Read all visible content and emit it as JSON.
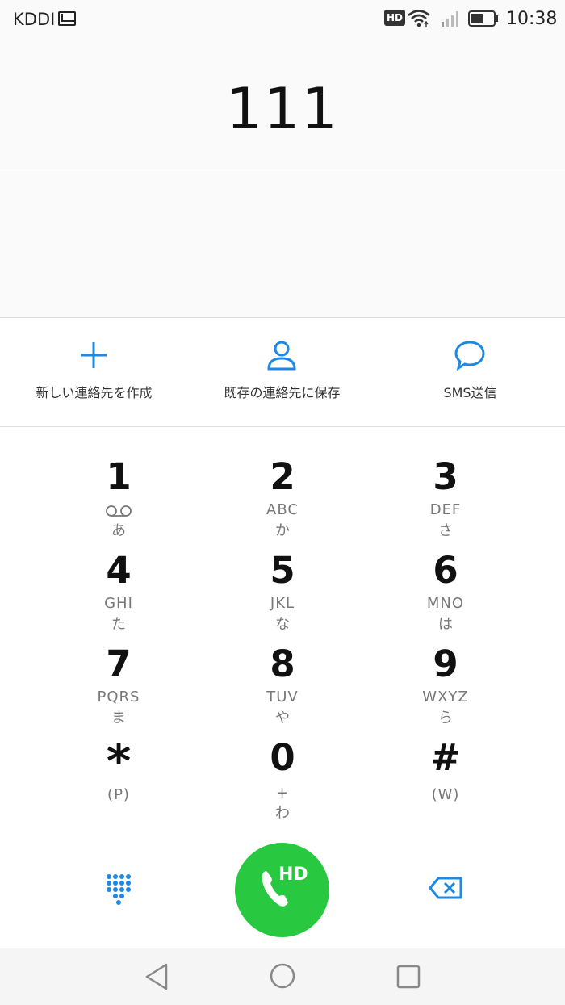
{
  "status_bar": {
    "carrier": "KDDI",
    "hd_badge": "HD",
    "time": "10:38"
  },
  "dialer": {
    "number": "111"
  },
  "actions": [
    {
      "label": "新しい連絡先を作成",
      "icon": "plus-icon"
    },
    {
      "label": "既存の連絡先に保存",
      "icon": "person-icon"
    },
    {
      "label": "SMS送信",
      "icon": "chat-bubble-icon"
    }
  ],
  "keypad": {
    "keys": [
      {
        "digit": "1",
        "letters": "",
        "kana": "あ",
        "voicemail": true
      },
      {
        "digit": "2",
        "letters": "ABC",
        "kana": "か"
      },
      {
        "digit": "3",
        "letters": "DEF",
        "kana": "さ"
      },
      {
        "digit": "4",
        "letters": "GHI",
        "kana": "た"
      },
      {
        "digit": "5",
        "letters": "JKL",
        "kana": "な"
      },
      {
        "digit": "6",
        "letters": "MNO",
        "kana": "は"
      },
      {
        "digit": "7",
        "letters": "PQRS",
        "kana": "ま"
      },
      {
        "digit": "8",
        "letters": "TUV",
        "kana": "や"
      },
      {
        "digit": "9",
        "letters": "WXYZ",
        "kana": "ら"
      },
      {
        "digit": "*",
        "letters": "(P)",
        "kana": ""
      },
      {
        "digit": "0",
        "letters": "+",
        "kana": "わ"
      },
      {
        "digit": "#",
        "letters": "(W)",
        "kana": ""
      }
    ]
  },
  "call_button": {
    "label": "HD",
    "color": "#28c840"
  },
  "colors": {
    "accent": "#1e88e5",
    "call_green": "#28c840"
  }
}
